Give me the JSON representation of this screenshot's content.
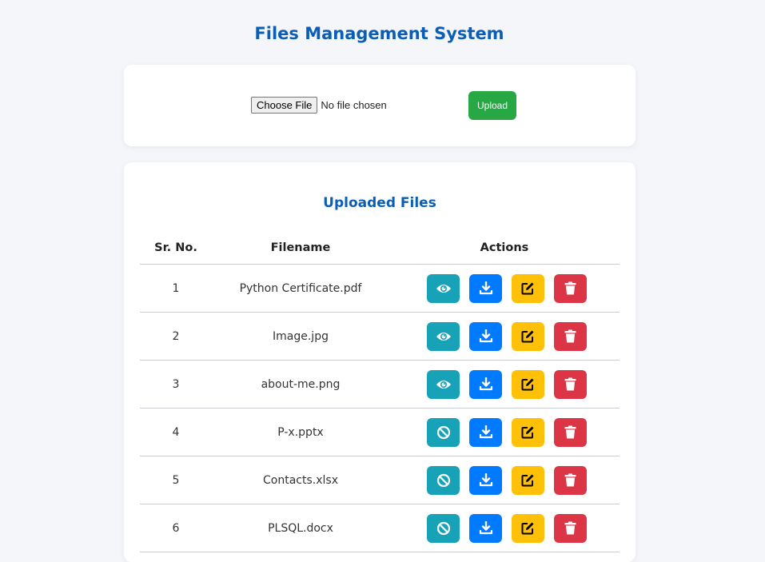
{
  "page": {
    "title": "Files Management System"
  },
  "upload": {
    "choose_label": "Choose File",
    "no_file_text": "No file chosen",
    "upload_label": "Upload"
  },
  "files_section": {
    "title": "Uploaded Files",
    "columns": [
      "Sr. No.",
      "Filename",
      "Actions"
    ],
    "rows": [
      {
        "sr": "1",
        "filename": "Python Certificate.pdf",
        "view_icon": "eye-icon"
      },
      {
        "sr": "2",
        "filename": "Image.jpg",
        "view_icon": "eye-icon"
      },
      {
        "sr": "3",
        "filename": "about-me.png",
        "view_icon": "eye-icon"
      },
      {
        "sr": "4",
        "filename": "P-x.pptx",
        "view_icon": "ban-icon"
      },
      {
        "sr": "5",
        "filename": "Contacts.xlsx",
        "view_icon": "ban-icon"
      },
      {
        "sr": "6",
        "filename": "PLSQL.docx",
        "view_icon": "ban-icon"
      }
    ]
  },
  "colors": {
    "title": "#0b5eb6",
    "upload": "#28a745",
    "view": "#17a2b8",
    "download": "#007bff",
    "edit": "#ffc107",
    "delete": "#dc3545"
  }
}
